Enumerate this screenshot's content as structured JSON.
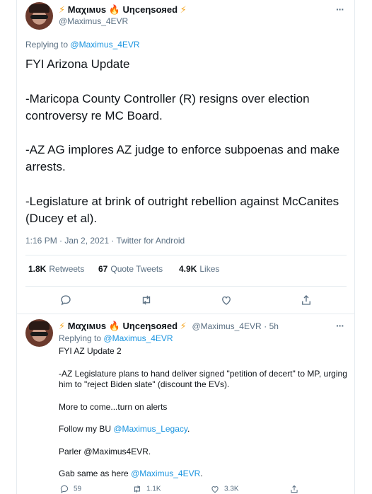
{
  "tweet": {
    "author_name_parts": {
      "name1": "Μαχιмυѕ",
      "name2": "Uηcеηѕояеd"
    },
    "handle": "@Maximus_4EVR",
    "replying_label": "Replying to",
    "replying_to": "@Maximus_4EVR",
    "lines": [
      "FYI Arizona Update",
      "-Maricopa County Controller (R) resigns over election controversy re MC Board.",
      "-AZ AG implores AZ judge to enforce subpoenas and make arrests.",
      "-Legislature at brink of outright rebellion against McCanites (Ducey et al)."
    ],
    "time": "1:16 PM · Jan 2, 2021 · Twitter for Android",
    "stats": {
      "retweets_count": "1.8K",
      "retweets_label": "Retweets",
      "quotes_count": "67",
      "quotes_label": "Quote Tweets",
      "likes_count": "4.9K",
      "likes_label": "Likes"
    }
  },
  "reply": {
    "author_name_parts": {
      "name1": "Μαχιмυѕ",
      "name2": "Uηcеηѕояеd"
    },
    "handle": "@Maximus_4EVR",
    "age": "5h",
    "replying_label": "Replying to",
    "replying_to": "@Maximus_4EVR",
    "line1": "FYI AZ Update 2",
    "line2": "-AZ Legislature plans to hand deliver signed \"petition of decert\" to MP, urging him to \"reject Biden slate\" (discount the EVs).",
    "line3": "More to come...turn on alerts",
    "line4_prefix": "Follow my BU ",
    "line4_link": "@Maximus_Legacy",
    "line4_suffix": ".",
    "line5": "Parler @Maximus4EVR.",
    "line6_prefix": "Gab same as here ",
    "line6_link": "@Maximus_4EVR",
    "line6_suffix": ".",
    "counts": {
      "replies": "59",
      "retweets": "1.1K",
      "likes": "3.3K"
    }
  },
  "icons": {
    "more": "more-icon",
    "reply": "reply-icon",
    "retweet": "retweet-icon",
    "like": "heart-icon",
    "share": "share-icon"
  },
  "colors": {
    "link": "#1b95e0",
    "muted": "#5b7083",
    "border": "#e6ecf0"
  }
}
